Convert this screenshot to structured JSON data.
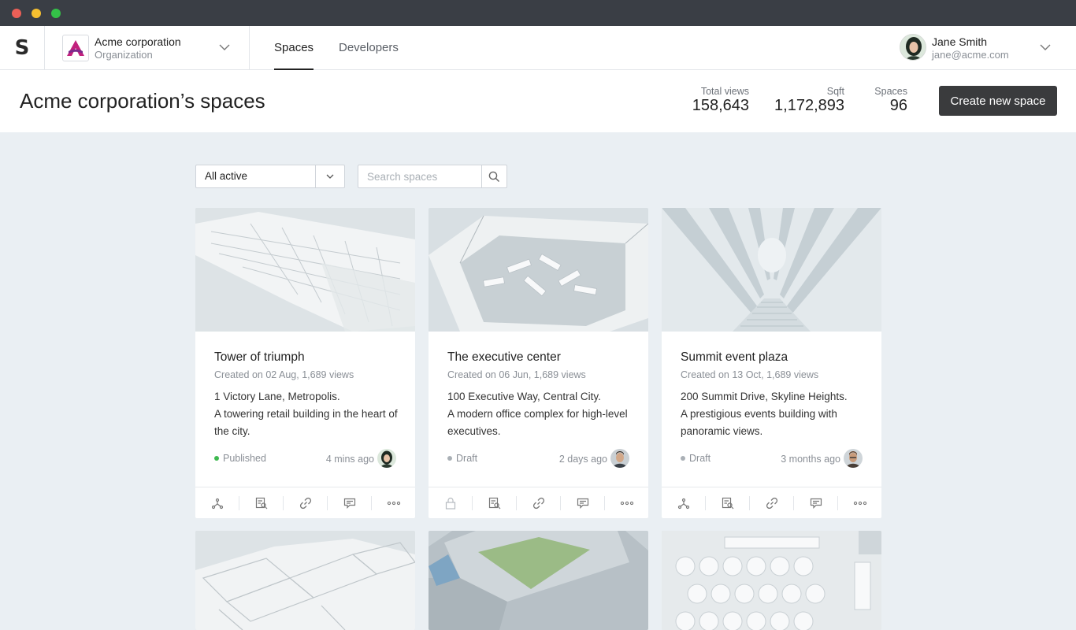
{
  "app": {
    "logo_letter": "S",
    "org_name": "Acme corporation",
    "org_subtitle": "Organization",
    "tabs": [
      {
        "label": "Spaces",
        "active": true
      },
      {
        "label": "Developers",
        "active": false
      }
    ],
    "user_name": "Jane Smith",
    "user_email": "jane@acme.com",
    "brand_color": "#c2217d"
  },
  "header": {
    "title": "Acme corporation’s spaces",
    "stats": [
      {
        "label": "Total views",
        "value": "158,643"
      },
      {
        "label": "Sqft",
        "value": "1,172,893"
      },
      {
        "label": "Spaces",
        "value": "96"
      }
    ],
    "create_button": "Create new space"
  },
  "filters": {
    "status_selected": "All active",
    "search_placeholder": "Search spaces"
  },
  "cards": [
    {
      "title": "Tower of triumph",
      "meta": "Created on 02 Aug, 1,689 views",
      "address": "1 Victory Lane, Metropolis.",
      "description": "A towering retail building in the heart of the city.",
      "status": "Published",
      "updated": "4 mins ago"
    },
    {
      "title": "The executive center",
      "meta": "Created on 06 Jun, 1,689 views",
      "address": "100 Executive Way, Central City.",
      "description": "A modern office complex for high-level executives.",
      "status": "Draft",
      "updated": "2 days ago"
    },
    {
      "title": "Summit event plaza",
      "meta": "Created on 13 Oct, 1,689 views",
      "address": "200 Summit Drive, Skyline Heights.",
      "description": "A prestigious events building with panoramic views.",
      "status": "Draft",
      "updated": "3 months ago"
    }
  ],
  "card_actions": [
    "share-icon",
    "inspect-icon",
    "link-icon",
    "comment-icon",
    "more-icon"
  ],
  "status_colors": {
    "published": "#3fb950",
    "draft": "#aab0b6"
  }
}
